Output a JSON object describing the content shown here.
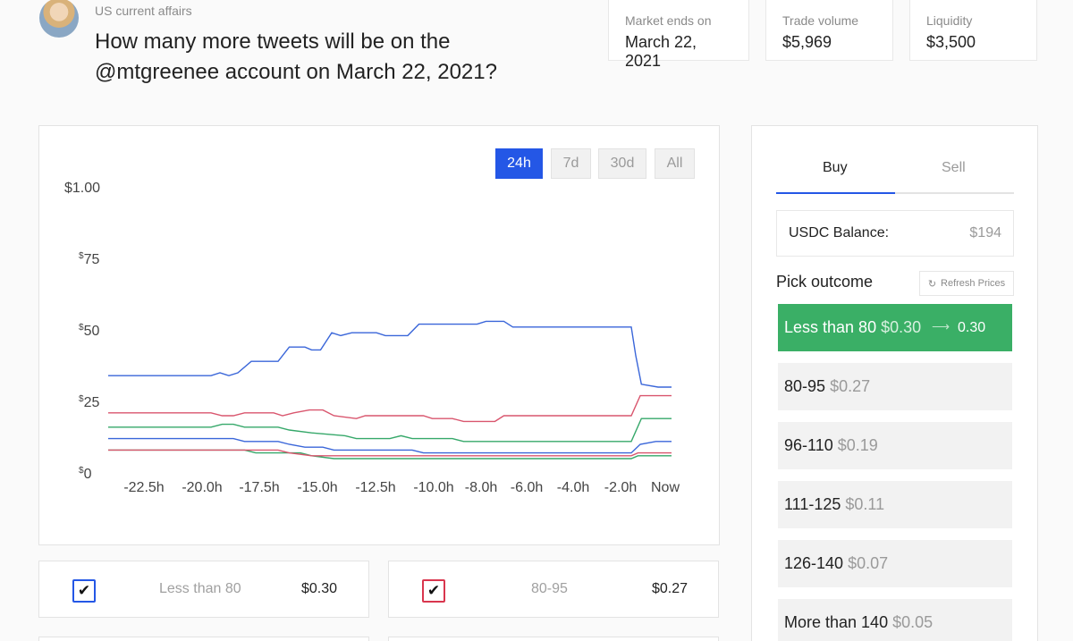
{
  "header": {
    "category": "US current affairs",
    "question": "How many more tweets will be on the @mtgreenee account on March 22, 2021?"
  },
  "stats": [
    {
      "label": "Market ends on",
      "value": "March 22, 2021"
    },
    {
      "label": "Trade volume",
      "value": "$5,969"
    },
    {
      "label": "Liquidity",
      "value": "$3,500"
    }
  ],
  "range_buttons": [
    "24h",
    "7d",
    "30d",
    "All"
  ],
  "active_range": "24h",
  "chart_data": {
    "type": "line",
    "x_labels": [
      "-22.5h",
      "-20.0h",
      "-17.5h",
      "-15.0h",
      "-12.5h",
      "-10.0h",
      "-8.0h",
      "-6.0h",
      "-4.0h",
      "-2.0h",
      "Now"
    ],
    "y_ticks": [
      "$1.00",
      "$75",
      "$50",
      "$25",
      "$0"
    ],
    "ylim": [
      0,
      1
    ],
    "xlim": [
      -24,
      0
    ],
    "grid": false,
    "series": [
      {
        "color": "#3a66d9",
        "points": [
          [
            -24,
            0.34
          ],
          [
            -19.4,
            0.34
          ],
          [
            -19,
            0.35
          ],
          [
            -18.6,
            0.34
          ],
          [
            -18.2,
            0.35
          ],
          [
            -17.6,
            0.39
          ],
          [
            -16.4,
            0.39
          ],
          [
            -15.9,
            0.44
          ],
          [
            -15.2,
            0.44
          ],
          [
            -14.9,
            0.43
          ],
          [
            -14.5,
            0.43
          ],
          [
            -14.0,
            0.49
          ],
          [
            -13.6,
            0.48
          ],
          [
            -13.1,
            0.49
          ],
          [
            -12.0,
            0.49
          ],
          [
            -11.6,
            0.48
          ],
          [
            -10.6,
            0.48
          ],
          [
            -10.1,
            0.52
          ],
          [
            -7.5,
            0.52
          ],
          [
            -7.1,
            0.53
          ],
          [
            -6.3,
            0.53
          ],
          [
            -5.9,
            0.51
          ],
          [
            -0.6,
            0.51
          ],
          [
            -0.4,
            0.41
          ],
          [
            -0.15,
            0.31
          ],
          [
            0.6,
            0.3
          ],
          [
            1.2,
            0.3
          ]
        ]
      },
      {
        "color": "#d9566e",
        "points": [
          [
            -24,
            0.21
          ],
          [
            -19.4,
            0.21
          ],
          [
            -18.9,
            0.2
          ],
          [
            -18.4,
            0.2
          ],
          [
            -17.9,
            0.21
          ],
          [
            -16.6,
            0.21
          ],
          [
            -16.2,
            0.2
          ],
          [
            -15.7,
            0.21
          ],
          [
            -15.0,
            0.22
          ],
          [
            -14.4,
            0.22
          ],
          [
            -13.9,
            0.2
          ],
          [
            -12.9,
            0.19
          ],
          [
            -12.5,
            0.2
          ],
          [
            -9.9,
            0.2
          ],
          [
            -9.5,
            0.19
          ],
          [
            -8.6,
            0.19
          ],
          [
            -8.1,
            0.18
          ],
          [
            -6.7,
            0.18
          ],
          [
            -6.3,
            0.2
          ],
          [
            -0.6,
            0.2
          ],
          [
            -0.2,
            0.27
          ],
          [
            1.2,
            0.27
          ]
        ]
      },
      {
        "color": "#36a86a",
        "points": [
          [
            -24,
            0.16
          ],
          [
            -19.4,
            0.16
          ],
          [
            -18.9,
            0.17
          ],
          [
            -18.4,
            0.17
          ],
          [
            -17.9,
            0.16
          ],
          [
            -16.4,
            0.16
          ],
          [
            -15.9,
            0.15
          ],
          [
            -14.9,
            0.14
          ],
          [
            -13.4,
            0.13
          ],
          [
            -12.9,
            0.12
          ],
          [
            -11.4,
            0.12
          ],
          [
            -10.9,
            0.13
          ],
          [
            -10.4,
            0.12
          ],
          [
            -8.6,
            0.12
          ],
          [
            -8.1,
            0.11
          ],
          [
            -0.6,
            0.11
          ],
          [
            -0.15,
            0.19
          ],
          [
            0.6,
            0.19
          ],
          [
            1.2,
            0.19
          ]
        ]
      },
      {
        "color": "#3a66d9",
        "points": [
          [
            -24,
            0.12
          ],
          [
            -18.4,
            0.12
          ],
          [
            -17.9,
            0.11
          ],
          [
            -16.4,
            0.11
          ],
          [
            -15.9,
            0.1
          ],
          [
            -15.2,
            0.09
          ],
          [
            -14.4,
            0.09
          ],
          [
            -13.9,
            0.08
          ],
          [
            -10.4,
            0.08
          ],
          [
            -9.9,
            0.07
          ],
          [
            -0.6,
            0.07
          ],
          [
            -0.2,
            0.1
          ],
          [
            0.5,
            0.11
          ],
          [
            1.2,
            0.11
          ]
        ]
      },
      {
        "color": "#36a86a",
        "points": [
          [
            -24,
            0.08
          ],
          [
            -17.9,
            0.08
          ],
          [
            -17.4,
            0.07
          ],
          [
            -15.4,
            0.07
          ],
          [
            -14.9,
            0.06
          ],
          [
            -13.9,
            0.05
          ],
          [
            -0.6,
            0.05
          ],
          [
            -0.3,
            0.06
          ],
          [
            1.2,
            0.06
          ]
        ]
      },
      {
        "color": "#d9566e",
        "points": [
          [
            -24,
            0.08
          ],
          [
            -16.4,
            0.08
          ],
          [
            -15.9,
            0.07
          ],
          [
            -14.9,
            0.06
          ],
          [
            -0.6,
            0.06
          ],
          [
            -0.3,
            0.07
          ],
          [
            1.2,
            0.07
          ]
        ]
      }
    ]
  },
  "outcome_cards": [
    {
      "name": "Less than 80",
      "price": "$0.30",
      "check_color": "#2457e6"
    },
    {
      "name": "80-95",
      "price": "$0.27",
      "check_color": "#d9364e"
    }
  ],
  "trade": {
    "tabs": [
      "Buy",
      "Sell"
    ],
    "balance_label": "USDC Balance:",
    "balance_value": "$194",
    "pick_label": "Pick outcome",
    "refresh_label": "Refresh Prices",
    "options": [
      {
        "name": "Less than 80",
        "price": "$0.30",
        "new_price": "0.30"
      },
      {
        "name": "80-95",
        "price": "$0.27"
      },
      {
        "name": "96-110",
        "price": "$0.19"
      },
      {
        "name": "111-125",
        "price": "$0.11"
      },
      {
        "name": "126-140",
        "price": "$0.07"
      },
      {
        "name": "More than 140",
        "price": "$0.05"
      }
    ]
  },
  "colors": {
    "accent": "#2457e6",
    "selected_option": "#3aaf66"
  }
}
